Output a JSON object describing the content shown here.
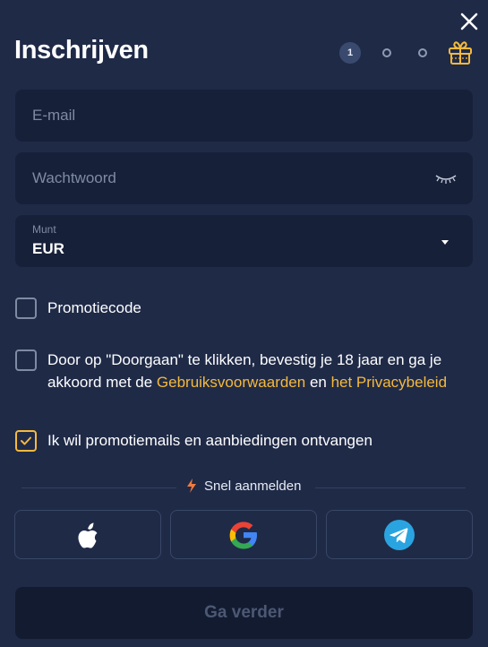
{
  "header": {
    "title": "Inschrijven",
    "close_icon": "close-icon",
    "steps": {
      "current": "1",
      "total": 3
    },
    "gift_icon": "gift-icon"
  },
  "form": {
    "email_placeholder": "E-mail",
    "password_placeholder": "Wachtwoord",
    "password_toggle_icon": "eye-closed-icon",
    "currency": {
      "label": "Munt",
      "value": "EUR"
    }
  },
  "checkboxes": {
    "promo_code": {
      "label": "Promotiecode",
      "checked": false
    },
    "terms": {
      "text_before": "Door op \"Doorgaan\" te klikken, bevestig je 18 jaar en ga je akkoord met de ",
      "link_terms": "Gebruiksvoorwaarden",
      "text_between": " en ",
      "link_privacy": "het Privacybeleid",
      "checked": false
    },
    "promo_emails": {
      "label": "Ik wil promotiemails en aanbiedingen ontvangen",
      "checked": true
    }
  },
  "quick_signup": {
    "label": "Snel aanmelden",
    "providers": [
      {
        "name": "Apple",
        "icon": "apple-icon"
      },
      {
        "name": "Google",
        "icon": "google-icon"
      },
      {
        "name": "Telegram",
        "icon": "telegram-icon"
      }
    ]
  },
  "continue_label": "Ga verder",
  "colors": {
    "background": "#1f2a47",
    "field": "#172039",
    "accent": "#f5b93c",
    "muted": "#7f8aa3",
    "button_disabled": "#131b30"
  }
}
